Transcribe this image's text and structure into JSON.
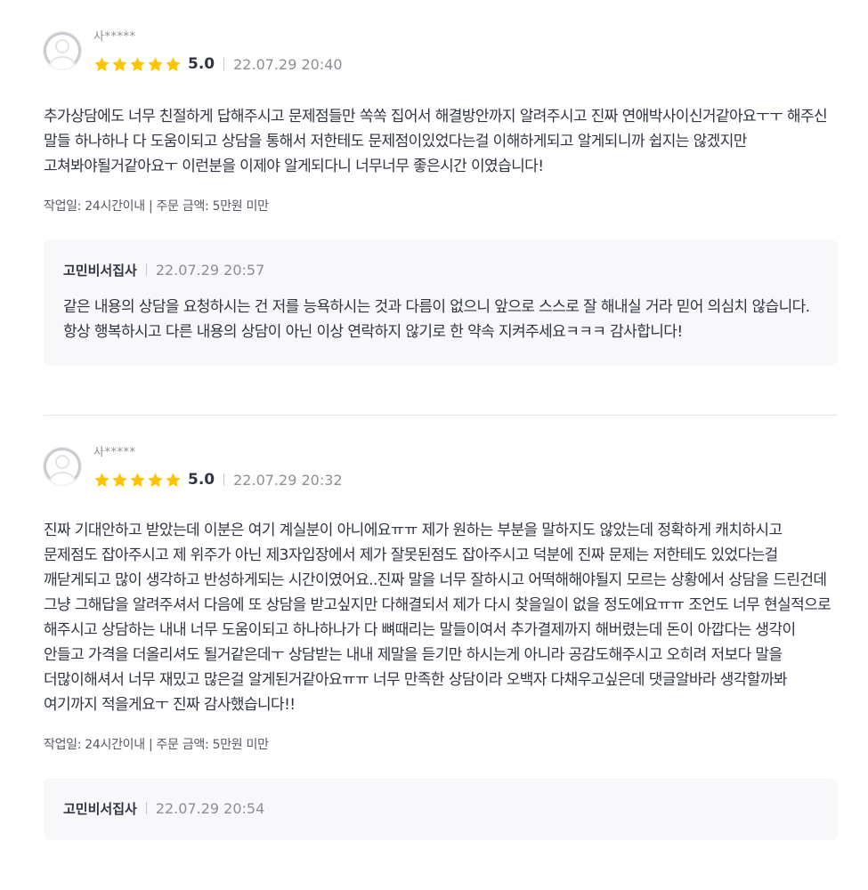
{
  "reviews": [
    {
      "user_name": "사*****",
      "rating": "5.0",
      "rating_value": 5,
      "date": "22.07.29 20:40",
      "text": "추가상담에도 너무 친절하게 답해주시고 문제점들만 쏙쏙 집어서 해결방안까지 알려주시고 진짜 연애박사이신거같아요ㅜㅜ 해주신 말들 하나하나 다 도움이되고 상담을 통해서 저한테도 문제점이있었다는걸 이해하게되고 알게되니까 쉽지는 않겠지만 고쳐봐야될거같아요ㅜ 이런분을 이제야 알게되다니 너무너무 좋은시간 이였습니다!",
      "meta": "작업일: 24시간이내 | 주문 금액: 5만원 미만",
      "reply": {
        "author": "고민비서집사",
        "date": "22.07.29 20:57",
        "text": "같은 내용의 상담을 요청하시는 건 저를 능욕하시는 것과 다름이 없으니 앞으로 스스로 잘 해내실 거라 믿어 의심치 않습니다. 항상 행복하시고 다른 내용의 상담이 아닌 이상 연락하지 않기로 한 약속 지켜주세요ㅋㅋㅋ 감사합니다!"
      }
    },
    {
      "user_name": "사*****",
      "rating": "5.0",
      "rating_value": 5,
      "date": "22.07.29 20:32",
      "text": "진짜 기대안하고 받았는데 이분은 여기 계실분이 아니에요ㅠㅠ 제가 원하는 부분을 말하지도 않았는데 정확하게 캐치하시고 문제점도 잡아주시고 제 위주가 아닌 제3자입장에서 제가 잘못된점도 잡아주시고 덕분에 진짜 문제는 저한테도 있었다는걸 깨닫게되고 많이 생각하고 반성하게되는 시간이였어요..진짜 말을 너무 잘하시고 어떡해해야될지 모르는 상황에서 상담을 드린건데 그냥 그해답을 알려주셔서 다음에 또 상담을 받고싶지만 다해결되서 제가 다시 찾을일이 없을 정도에요ㅠㅠ 조언도 너무 현실적으로 해주시고 상담하는 내내 너무 도움이되고 하나하나가 다 뼈때리는 말들이여서 추가결제까지 해버렸는데 돈이 아깝다는 생각이 안들고 가격을 더올리셔도 될거같은데ㅜ 상담받는 내내 제말을 듣기만 하시는게 아니라 공감도해주시고 오히려 저보다 말을 더많이해셔서 너무 재밌고 많은걸 알게된거같아요ㅠㅠ 너무 만족한 상담이라 오백자 다채우고싶은데 댓글알바라 생각할까봐 여기까지 적을게요ㅜ 진짜 감사했습니다!!",
      "meta": "작업일: 24시간이내 | 주문 금액: 5만원 미만",
      "reply": {
        "author": "고민비서집사",
        "date": "22.07.29 20:54"
      }
    }
  ],
  "colors": {
    "star": "#FFC400",
    "text": "#303441",
    "muted": "#8D8F95",
    "reply_bg": "#F8F8FA",
    "divider": "#E4E5E8"
  },
  "icons": {
    "avatar": "user-avatar-placeholder-icon",
    "star": "star-filled-icon"
  }
}
